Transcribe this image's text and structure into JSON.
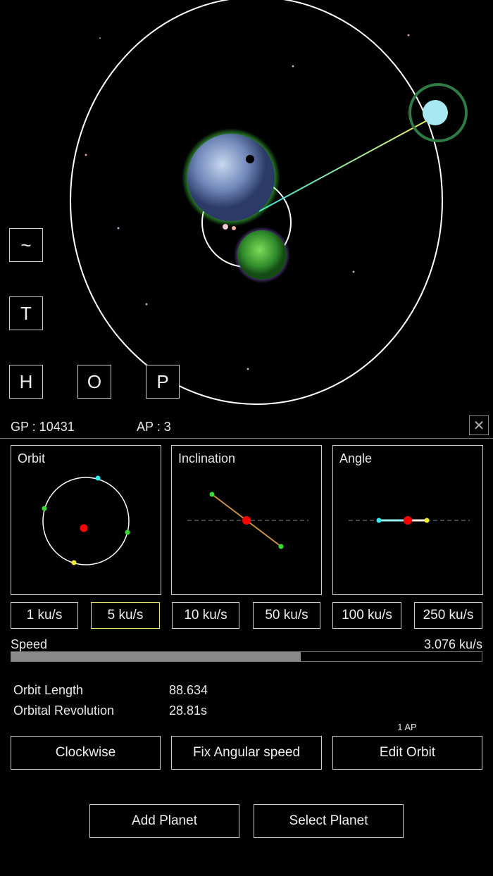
{
  "scene": {
    "buttons": {
      "tilde": "~",
      "t": "T",
      "h": "H",
      "o": "O",
      "p": "P"
    }
  },
  "status": {
    "gp": "GP : 10431",
    "ap": "AP : 3",
    "close_icon": "close-icon"
  },
  "panels": {
    "orbit": "Orbit",
    "inclination": "Inclination",
    "angle": "Angle"
  },
  "speed_buttons": [
    "1 ku/s",
    "5 ku/s",
    "10 ku/s",
    "50 ku/s",
    "100 ku/s",
    "250 ku/s"
  ],
  "selected_speed_button": "5 ku/s",
  "speed": {
    "label": "Speed",
    "value": "3.076 ku/s",
    "fill_fraction": 0.615
  },
  "stats": {
    "orbit_length_label": "Orbit Length",
    "orbit_length": "88.634",
    "revolution_label": "Orbital Revolution",
    "revolution": "28.81s"
  },
  "actions": {
    "clockwise": "Clockwise",
    "fix": "Fix Angular speed",
    "edit": "Edit Orbit",
    "edit_cost": "1 AP",
    "add": "Add Planet",
    "select": "Select Planet"
  },
  "colors": {
    "selected_border": "#e8e070",
    "bar_fill": "#8a8a8a"
  }
}
